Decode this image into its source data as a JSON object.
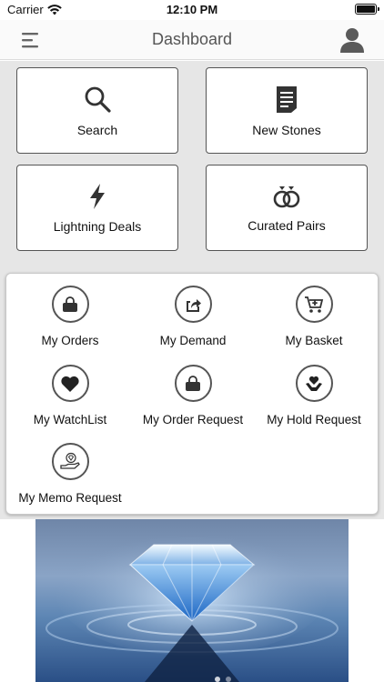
{
  "status_bar": {
    "carrier": "Carrier",
    "time": "12:10 PM"
  },
  "nav": {
    "title": "Dashboard",
    "menu_icon": "hamburger-menu-icon",
    "profile_icon": "user-profile-icon"
  },
  "tiles": [
    {
      "label": "Search",
      "icon": "magnifier-icon"
    },
    {
      "label": "New Stones",
      "icon": "document-list-icon"
    },
    {
      "label": "Lightning Deals",
      "icon": "lightning-bolt-icon"
    },
    {
      "label": "Curated Pairs",
      "icon": "paired-rings-icon"
    }
  ],
  "menu": [
    {
      "label": "My Orders",
      "icon": "shopping-bag-icon"
    },
    {
      "label": "My Demand",
      "icon": "share-arrow-icon"
    },
    {
      "label": "My Basket",
      "icon": "cart-add-icon"
    },
    {
      "label": "My WatchList",
      "icon": "heart-icon"
    },
    {
      "label": "My Order Request",
      "icon": "bag-icon"
    },
    {
      "label": "My Hold Request",
      "icon": "hand-heart-icon"
    },
    {
      "label": "My Memo Request",
      "icon": "hand-diamond-icon"
    }
  ],
  "banner": {
    "image": "diamond-on-water-photo"
  },
  "colors": {
    "background": "#e6e6e6",
    "tile_border": "#555555",
    "nav_background": "#fafafa"
  }
}
